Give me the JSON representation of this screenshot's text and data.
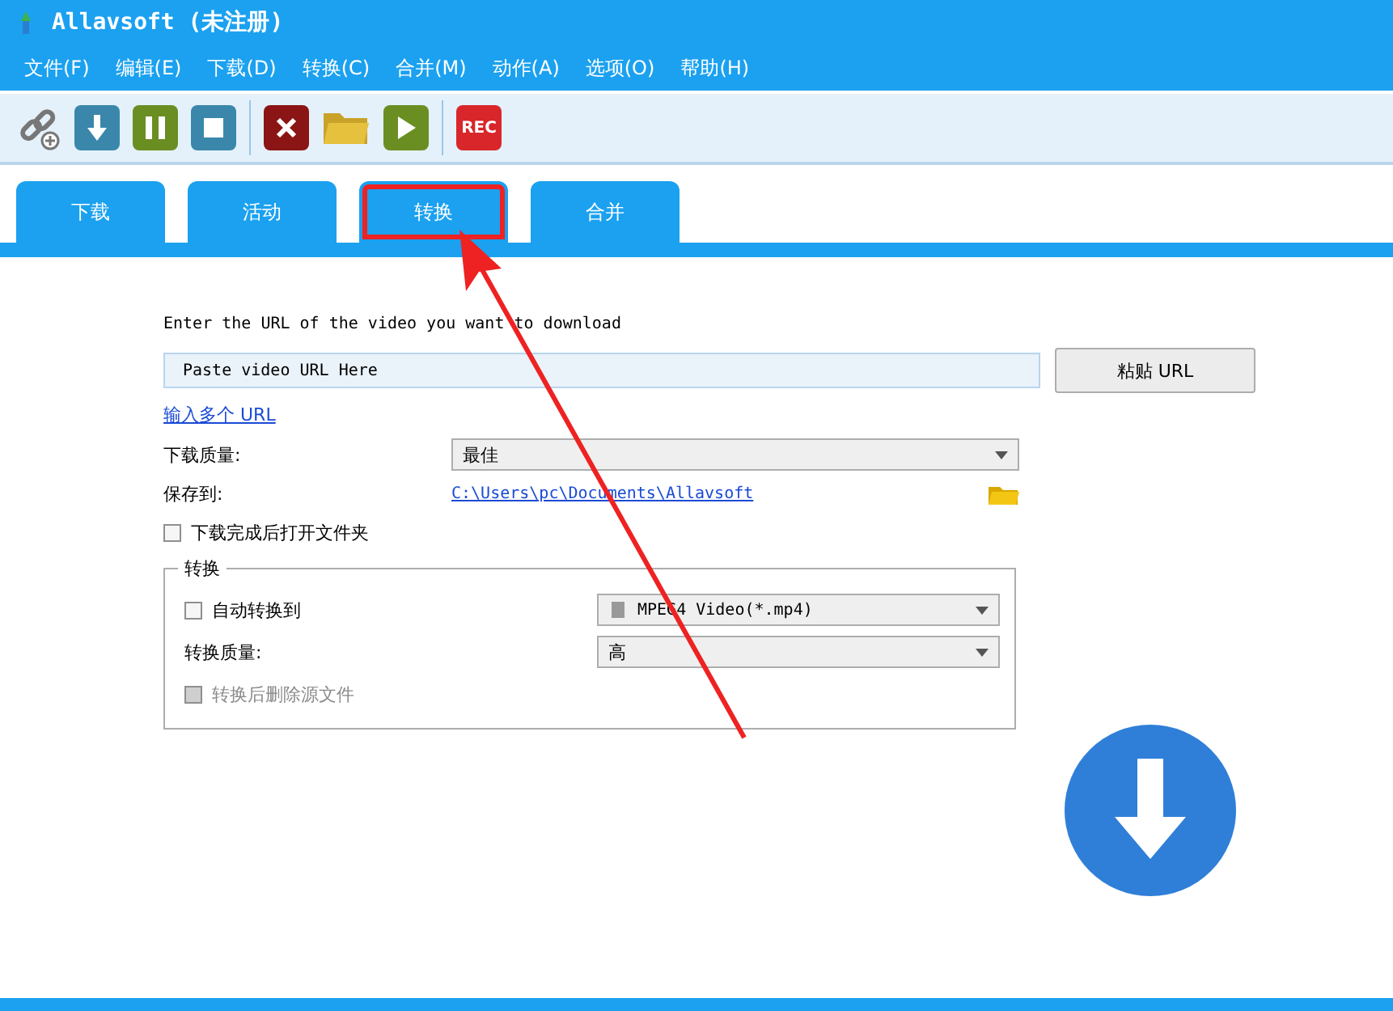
{
  "window": {
    "title": "Allavsoft (未注册)"
  },
  "menu": [
    "文件(F)",
    "编辑(E)",
    "下载(D)",
    "转换(C)",
    "合并(M)",
    "动作(A)",
    "选项(O)",
    "帮助(H)"
  ],
  "toolbar": [
    {
      "kind": "link"
    },
    {
      "kind": "download"
    },
    {
      "kind": "pause"
    },
    {
      "kind": "stop"
    },
    {
      "kind": "sep"
    },
    {
      "kind": "delete"
    },
    {
      "kind": "folder"
    },
    {
      "kind": "play"
    },
    {
      "kind": "sep"
    },
    {
      "kind": "rec",
      "label": "REC"
    }
  ],
  "tabs": [
    {
      "label": "下载",
      "annotated": false
    },
    {
      "label": "活动",
      "annotated": false
    },
    {
      "label": "转换",
      "annotated": true
    },
    {
      "label": "合并",
      "annotated": false
    }
  ],
  "form": {
    "prompt": "Enter the URL of the video you want to download",
    "url_value": "Paste video URL Here",
    "paste_button": "粘贴 URL",
    "multi_link": "输入多个 URL",
    "quality_label": "下载质量:",
    "quality_value": "最佳",
    "save_label": "保存到:",
    "save_path": "C:\\Users\\pc\\Documents\\Allavsoft",
    "open_folder": {
      "label": "下载完成后打开文件夹",
      "checked": false
    }
  },
  "convert_group": {
    "title": "转换",
    "auto_convert": {
      "label": "自动转换到",
      "checked": false
    },
    "format_value": "MPEG4 Video(*.mp4)",
    "quality_label": "转换质量:",
    "quality_value": "高",
    "delete_source": {
      "label": "转换后删除源文件",
      "checked": false,
      "disabled": true
    }
  }
}
